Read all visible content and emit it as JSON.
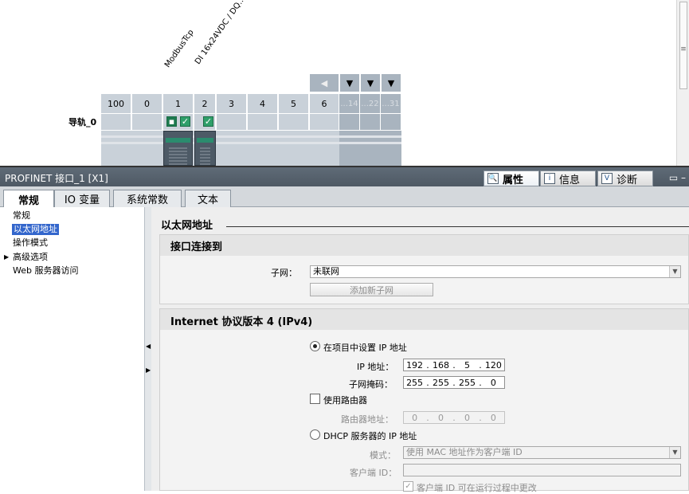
{
  "device_view": {
    "module_labels": [
      "ModbusTcp",
      "DI 16x24VDC / DQ..."
    ],
    "rail_label": "导轨_0",
    "slots": [
      "100",
      "0",
      "1",
      "2",
      "3",
      "4",
      "5",
      "6"
    ],
    "grey_slots": [
      "...14",
      "...22",
      "...31"
    ],
    "nav_buttons": [
      "◀",
      "▼",
      "▼",
      "▼"
    ]
  },
  "properties": {
    "title": "PROFINET 接口_1 [X1]",
    "pane_tabs": [
      {
        "label": "属性",
        "icon": "properties-icon",
        "glyph": "🔍"
      },
      {
        "label": "信息",
        "icon": "info-icon",
        "glyph": "i"
      },
      {
        "label": "诊断",
        "icon": "diagnostics-icon",
        "glyph": "V"
      }
    ],
    "tabs": [
      "常规",
      "IO 变量",
      "系统常数",
      "文本"
    ],
    "nav": [
      {
        "label": "常规"
      },
      {
        "label": "以太网地址",
        "selected": true
      },
      {
        "label": "操作模式"
      },
      {
        "label": "高级选项",
        "expandable": true
      },
      {
        "label": "Web 服务器访问"
      }
    ]
  },
  "content": {
    "section_title": "以太网地址",
    "interface_group": {
      "title": "接口连接到",
      "subnet_label": "子网：",
      "subnet_value": "未联网",
      "add_subnet_button": "添加新子网"
    },
    "ipv4_group": {
      "title": "Internet 协议版本 4 (IPv4)",
      "set_in_project_label": "在项目中设置 IP 地址",
      "ip_label": "IP 地址：",
      "ip_address": [
        "192",
        "168",
        "5",
        "120"
      ],
      "mask_label": "子网掩码：",
      "subnet_mask": [
        "255",
        "255",
        "255",
        "0"
      ],
      "use_router_label": "使用路由器",
      "router_label": "路由器地址：",
      "router_address": [
        "0",
        "0",
        "0",
        "0"
      ],
      "dhcp_label": "DHCP 服务器的 IP 地址",
      "mode_label": "模式：",
      "mode_value": "使用 MAC 地址作为客户端 ID",
      "client_id_label": "客户端 ID：",
      "client_id_value": "",
      "client_change_label": "客户端 ID 可在运行过程中更改"
    }
  }
}
